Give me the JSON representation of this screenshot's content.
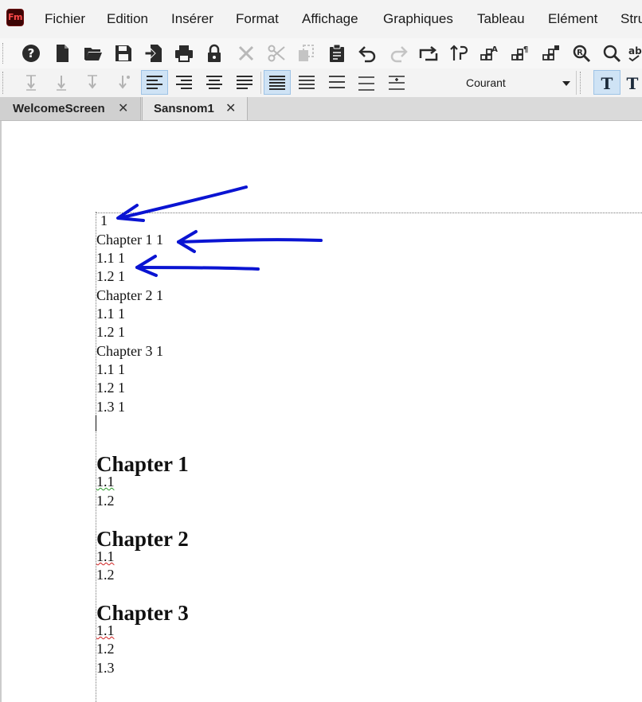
{
  "app": {
    "icon_text": "Fm"
  },
  "menu": [
    "Fichier",
    "Edition",
    "Insérer",
    "Format",
    "Affichage",
    "Graphiques",
    "Tableau",
    "Elément",
    "Stru"
  ],
  "toolbar": {
    "icons": [
      "help-icon",
      "new-document-icon",
      "open-folder-icon",
      "save-icon",
      "import-file-icon",
      "print-icon",
      "lock-icon",
      "delete-icon",
      "cut-icon",
      "copy-icon",
      "paste-icon",
      "undo-icon",
      "redo-icon",
      "repeat-icon",
      "swap-icon",
      "show-hide-markers-icon",
      "show-hide-paragraph-icon",
      "show-hide-table-icon",
      "find-replace-icon",
      "zoom-icon",
      "spelling-icon"
    ],
    "font_value": "Courant"
  },
  "tabs": [
    {
      "label": "WelcomeScreen",
      "close": "✕"
    },
    {
      "label": "Sansnom1",
      "close": "✕"
    }
  ],
  "document": {
    "toc_title": "1",
    "toc": [
      {
        "text": "Chapter 1 1"
      },
      {
        "text": "1.1 1"
      },
      {
        "text": "1.2 1"
      },
      {
        "text": "Chapter 2 1"
      },
      {
        "text": "1.1 1"
      },
      {
        "text": "1.2 1"
      },
      {
        "text": "Chapter 3 1"
      },
      {
        "text": "1.1 1"
      },
      {
        "text": "1.2 1"
      },
      {
        "text": "1.3 1"
      }
    ],
    "sections": [
      {
        "heading": "Chapter 1",
        "items": [
          "1.1",
          "1.2"
        ]
      },
      {
        "heading": "Chapter 2",
        "items": [
          "1.1",
          "1.2"
        ]
      },
      {
        "heading": "Chapter 3",
        "items": [
          "1.1",
          "1.2",
          "1.3"
        ]
      }
    ]
  },
  "annotation_color": "#0a14d2"
}
